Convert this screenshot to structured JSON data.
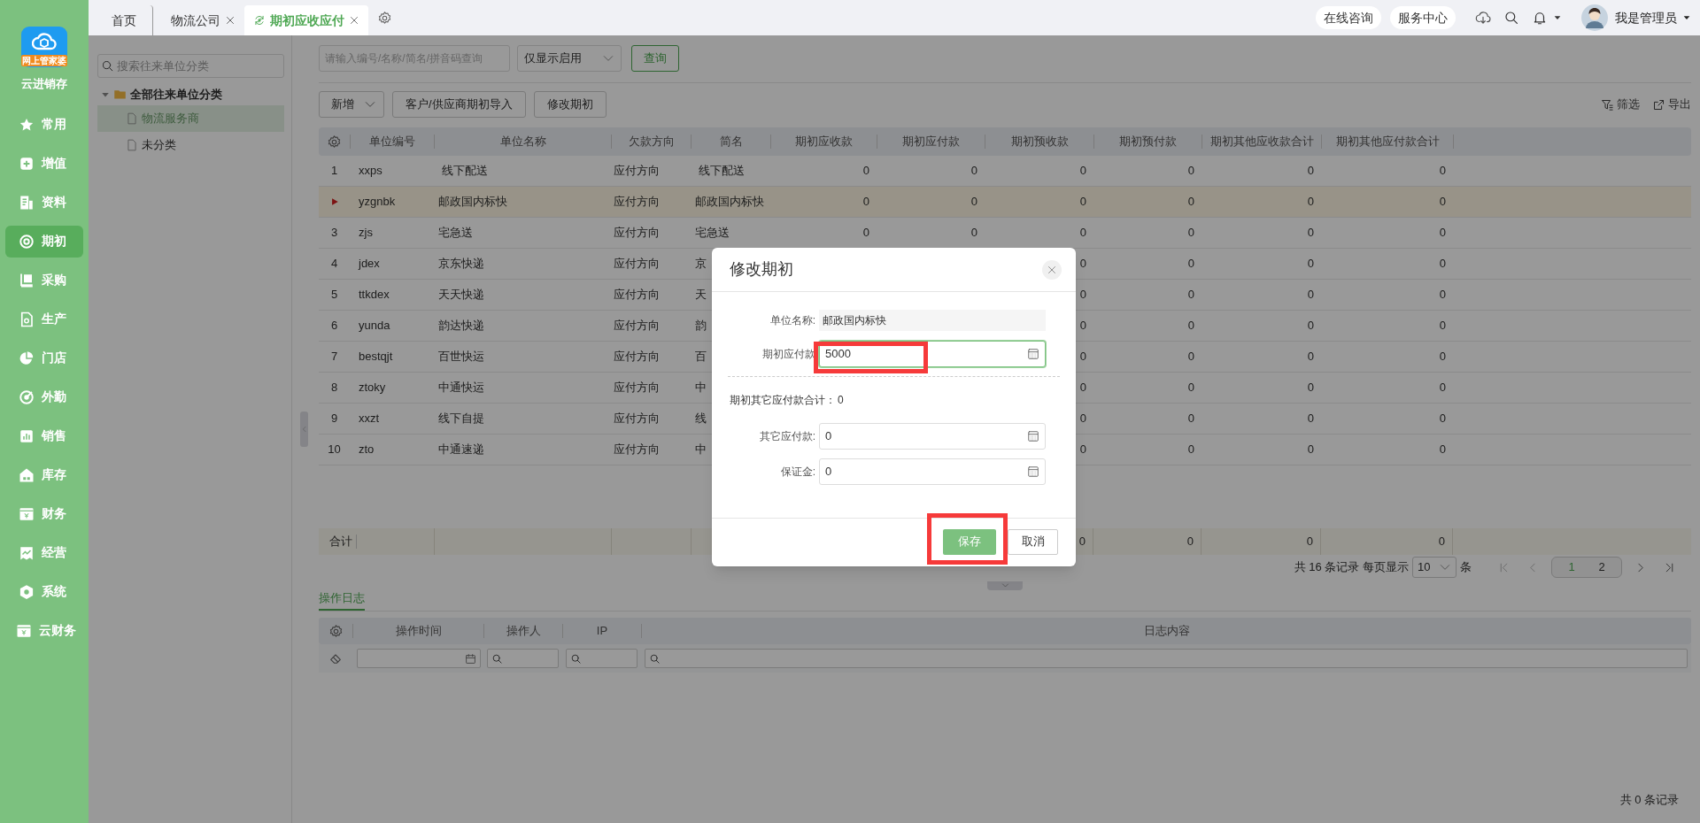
{
  "sidebar": {
    "logo_badge": "网上管家婆",
    "app_name": "云进销存",
    "items": [
      {
        "label": "常用",
        "selected": false
      },
      {
        "label": "增值",
        "selected": false
      },
      {
        "label": "资料",
        "selected": false
      },
      {
        "label": "期初",
        "selected": true
      },
      {
        "label": "采购",
        "selected": false
      },
      {
        "label": "生产",
        "selected": false
      },
      {
        "label": "门店",
        "selected": false
      },
      {
        "label": "外勤",
        "selected": false
      },
      {
        "label": "销售",
        "selected": false
      },
      {
        "label": "库存",
        "selected": false
      },
      {
        "label": "财务",
        "selected": false
      },
      {
        "label": "经营",
        "selected": false
      },
      {
        "label": "系统",
        "selected": false
      },
      {
        "label": "云财务",
        "selected": false
      }
    ]
  },
  "tabs": [
    {
      "label": "首页",
      "closable": false,
      "selected": false
    },
    {
      "label": "物流公司",
      "closable": true,
      "selected": false
    },
    {
      "label": "期初应收应付",
      "closable": true,
      "selected": true
    }
  ],
  "header": {
    "buttons": [
      "在线咨询",
      "服务中心"
    ],
    "user": "我是管理员"
  },
  "tree": {
    "search_placeholder": "搜索往来单位分类",
    "nodes": [
      {
        "label": "全部往来单位分类",
        "expanded": true,
        "selected": false,
        "children": [
          {
            "label": "物流服务商",
            "selected": true
          },
          {
            "label": "未分类",
            "selected": false
          }
        ]
      }
    ]
  },
  "toolbar": {
    "search_placeholder": "请输入编号/名称/简名/拼音码查询",
    "filter_value": "仅显示启用",
    "query_button": "查询",
    "actions": [
      {
        "label": "新增",
        "kind": "dropdown"
      },
      {
        "label": "客户/供应商期初导入",
        "kind": "button"
      },
      {
        "label": "修改期初",
        "kind": "button"
      }
    ],
    "tools": [
      "筛选",
      "导出"
    ]
  },
  "table": {
    "columns": [
      "单位编号",
      "单位名称",
      "欠款方向",
      "简名",
      "期初应收款",
      "期初应付款",
      "期初预收款",
      "期初预付款",
      "期初其他应收款合计",
      "期初其他应付款合计"
    ],
    "rows": [
      {
        "no": "1",
        "code": "xxps",
        "name": " 线下配送",
        "direction": "应付方向",
        "short": " 线下配送",
        "amounts": [
          "0",
          "0",
          "0",
          "0",
          "0",
          "0"
        ],
        "selected": false
      },
      {
        "code": "yzgnbk",
        "name": "邮政国内标快",
        "direction": "应付方向",
        "short": "邮政国内标快",
        "amounts": [
          "0",
          "0",
          "0",
          "0",
          "0",
          "0"
        ],
        "selected": true
      },
      {
        "no": "3",
        "code": "zjs",
        "name": "宅急送",
        "direction": "应付方向",
        "short": "宅急送",
        "amounts": [
          "0",
          "0",
          "0",
          "0",
          "0",
          "0"
        ],
        "selected": false
      },
      {
        "no": "4",
        "code": "jdex",
        "name": "京东快递",
        "direction": "应付方向",
        "short": "京",
        "amounts": [
          "0",
          "0",
          "0",
          "0"
        ],
        "selected": false
      },
      {
        "no": "5",
        "code": "ttkdex",
        "name": "天天快递",
        "direction": "应付方向",
        "short": "天",
        "amounts": [
          "0",
          "0",
          "0",
          "0"
        ],
        "selected": false
      },
      {
        "no": "6",
        "code": "yunda",
        "name": "韵达快递",
        "direction": "应付方向",
        "short": "韵",
        "amounts": [
          "0",
          "0",
          "0",
          "0"
        ],
        "selected": false
      },
      {
        "no": "7",
        "code": "bestqjt",
        "name": "百世快运",
        "direction": "应付方向",
        "short": "百",
        "amounts": [
          "0",
          "0",
          "0",
          "0"
        ],
        "selected": false
      },
      {
        "no": "8",
        "code": "ztoky",
        "name": "中通快运",
        "direction": "应付方向",
        "short": "中",
        "amounts": [
          "0",
          "0",
          "0",
          "0"
        ],
        "selected": false
      },
      {
        "no": "9",
        "code": "xxzt",
        "name": "线下自提",
        "direction": "应付方向",
        "short": "线",
        "amounts": [
          "0",
          "0",
          "0",
          "0"
        ],
        "selected": false
      },
      {
        "no": "10",
        "code": "zto",
        "name": "中通速递",
        "direction": "应付方向",
        "short": "中",
        "amounts": [
          "0",
          "0",
          "0",
          "0"
        ],
        "selected": false
      }
    ],
    "totals": {
      "label": "合计",
      "amounts": [
        "0",
        "0",
        "0",
        "0"
      ]
    }
  },
  "pagination": {
    "summary": "共 16 条记录 每页显示",
    "page_size": "10",
    "unit": "条",
    "pages": [
      {
        "label": "1",
        "selected": true
      },
      {
        "label": "2",
        "selected": false
      }
    ]
  },
  "log": {
    "tab": {
      "label": "操作日志",
      "selected": true
    },
    "columns": [
      "操作时间",
      "操作人",
      "IP",
      "日志内容"
    ],
    "footer": "共 0 条记录"
  },
  "dialog": {
    "title": "修改期初",
    "rows": [
      {
        "kind": "readonly",
        "label": "单位名称:",
        "value": "邮政国内标快"
      },
      {
        "kind": "number",
        "label": "期初应付款",
        "value": "5000",
        "focused": true,
        "highlighted": true
      },
      {
        "kind": "divider"
      },
      {
        "kind": "summary",
        "label": "期初其它应付款合计：",
        "value": "0"
      },
      {
        "kind": "number",
        "label": "其它应付款:",
        "value": "0",
        "focused": false,
        "highlighted": false
      },
      {
        "kind": "number",
        "label": "保证金:",
        "value": "0",
        "focused": false,
        "highlighted": false
      }
    ],
    "buttons": [
      {
        "label": "保存",
        "kind": "primary",
        "highlighted": true
      },
      {
        "label": "取消",
        "kind": "default"
      }
    ]
  }
}
